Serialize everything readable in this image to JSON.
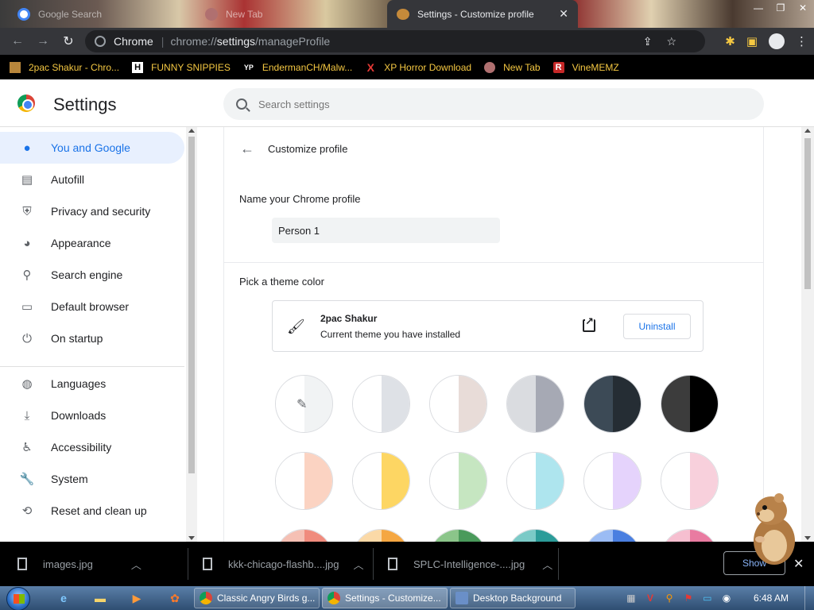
{
  "browser": {
    "tabs": [
      {
        "title": "Google Search",
        "active": false
      },
      {
        "title": "New Tab",
        "active": false
      },
      {
        "title": "Settings - Customize profile",
        "active": true
      }
    ],
    "omnibox": {
      "chip": "Chrome",
      "url_prefix": "chrome://",
      "url_host": "settings",
      "url_path": "/manageProfile"
    },
    "bookmarks": [
      {
        "label": "2pac Shakur - Chro...",
        "icon": "image-icon"
      },
      {
        "label": "FUNNY SNIPPIES",
        "icon": "H"
      },
      {
        "label": "EndermanCH/Malw...",
        "icon": "YP"
      },
      {
        "label": "XP Horror Download",
        "icon": "X"
      },
      {
        "label": "New Tab",
        "icon": "globe-icon"
      },
      {
        "label": "VineMEMZ",
        "icon": "R"
      }
    ]
  },
  "settings": {
    "title": "Settings",
    "search_placeholder": "Search settings",
    "nav": [
      {
        "label": "You and Google",
        "icon": "person-icon",
        "active": true
      },
      {
        "label": "Autofill",
        "icon": "clipboard-icon"
      },
      {
        "label": "Privacy and security",
        "icon": "shield-icon"
      },
      {
        "label": "Appearance",
        "icon": "palette-icon"
      },
      {
        "label": "Search engine",
        "icon": "search-icon"
      },
      {
        "label": "Default browser",
        "icon": "browser-icon"
      },
      {
        "label": "On startup",
        "icon": "power-icon"
      },
      {
        "label": "Languages",
        "icon": "globe-icon"
      },
      {
        "label": "Downloads",
        "icon": "download-icon"
      },
      {
        "label": "Accessibility",
        "icon": "accessibility-icon"
      },
      {
        "label": "System",
        "icon": "wrench-icon"
      },
      {
        "label": "Reset and clean up",
        "icon": "restore-icon"
      }
    ],
    "page": {
      "heading": "Customize profile",
      "name_section_label": "Name your Chrome profile",
      "profile_name_value": "Person 1",
      "theme_section_label": "Pick a theme color",
      "installed_theme": {
        "name": "2pac Shakur",
        "subtitle": "Current theme you have installed",
        "uninstall_label": "Uninstall"
      },
      "theme_colors": [
        {
          "left": "#ffffff",
          "right": "#f1f3f4",
          "picker": true
        },
        {
          "left": "#ffffff",
          "right": "#dee1e6"
        },
        {
          "left": "#ffffff",
          "right": "#e8dcd8"
        },
        {
          "left": "#dadce0",
          "right": "#a6a9b4"
        },
        {
          "left": "#3c4a56",
          "right": "#252d34"
        },
        {
          "left": "#3c3c3c",
          "right": "#000000"
        },
        {
          "left": "#ffffff",
          "right": "#fbd3c2"
        },
        {
          "left": "#ffffff",
          "right": "#fdd663"
        },
        {
          "left": "#ffffff",
          "right": "#c6e6c1"
        },
        {
          "left": "#ffffff",
          "right": "#aee5ee"
        },
        {
          "left": "#ffffff",
          "right": "#e5d3fc"
        },
        {
          "left": "#ffffff",
          "right": "#f8d0dc"
        },
        {
          "left": "#f5c0b4",
          "right": "#f08b7d"
        },
        {
          "left": "#fbd9a7",
          "right": "#f5a742"
        },
        {
          "left": "#8bc58a",
          "right": "#4a9a5b"
        },
        {
          "left": "#7bcac7",
          "right": "#2c9c99"
        },
        {
          "left": "#9bbcf4",
          "right": "#4a7fe0"
        },
        {
          "left": "#f6bfd0",
          "right": "#e97ba1"
        }
      ]
    }
  },
  "downloads": {
    "items": [
      "images.jpg",
      "kkk-chicago-flashb....jpg",
      "SPLC-Intelligence-....jpg"
    ],
    "show_all_label": "Show"
  },
  "taskbar": {
    "tasks": [
      {
        "label": "Classic Angry Birds g...",
        "icon": "chrome-icon"
      },
      {
        "label": "Settings - Customize...",
        "icon": "chrome-icon",
        "active": true
      },
      {
        "label": "Desktop Background",
        "icon": "desktop-icon"
      }
    ],
    "clock": "6:48 AM"
  }
}
